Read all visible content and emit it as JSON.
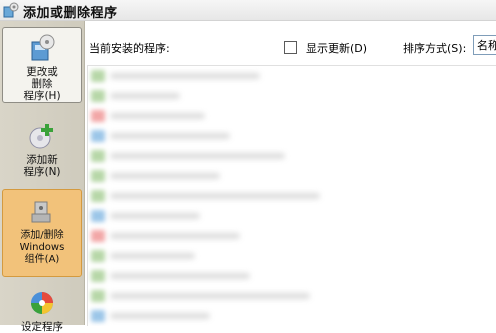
{
  "window": {
    "title": "添加或删除程序"
  },
  "sidebar": {
    "change_remove": "更改或\n删除\n程序(H)",
    "add_new": "添加新\n程序(N)",
    "add_remove_windows": "添加/删除\nWindows\n组件(A)",
    "set_defaults": "设定程序"
  },
  "main": {
    "current_label": "当前安装的程序:",
    "show_updates": "显示更新(D)",
    "show_updates_checked": false,
    "sort_label": "排序方式(S):",
    "sort_value": "名称"
  },
  "colors": {
    "highlight": "#f2c27a",
    "arrow": "#f7a531",
    "sidebar_bg": "#d9d5c8",
    "list_row_icons": [
      "#b7d7a8",
      "#b7d7a8",
      "#f2a7a7",
      "#9cc6e8",
      "#b7d7a8",
      "#b7d7a8",
      "#b7d7a8",
      "#9cc6e8",
      "#f2a7a7",
      "#b7d7a8",
      "#b7d7a8",
      "#b7d7a8",
      "#9cc6e8"
    ]
  }
}
